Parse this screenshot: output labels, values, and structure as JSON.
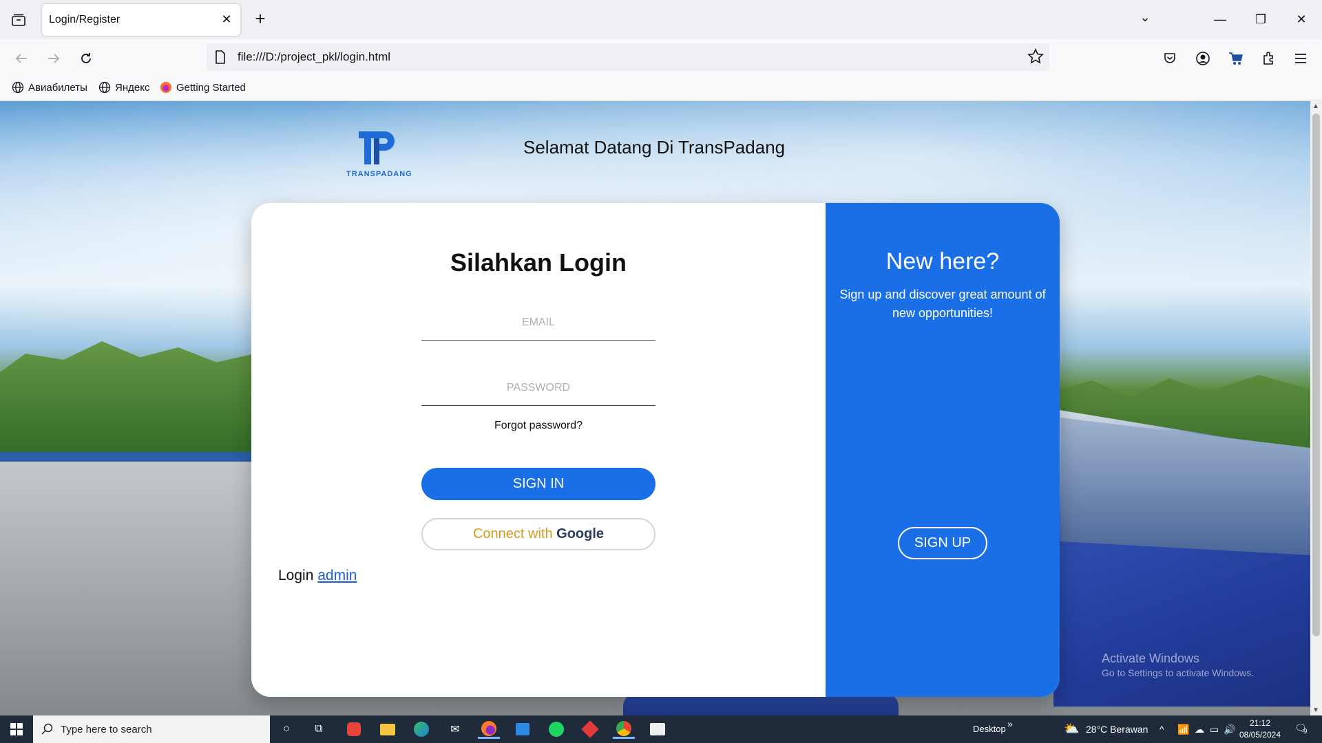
{
  "browser": {
    "tab_title": "Login/Register",
    "url": "file:///D:/project_pkl/login.html",
    "bookmarks": [
      {
        "label": "Авиабилеты",
        "icon": "globe-icon"
      },
      {
        "label": "Яндекс",
        "icon": "globe-icon"
      },
      {
        "label": "Getting Started",
        "icon": "firefox-icon"
      }
    ]
  },
  "page": {
    "brand_text": "TRANSPADANG",
    "welcome": "Selamat Datang Di TransPadang",
    "login": {
      "title": "Silahkan Login",
      "email_placeholder": "EMAIL",
      "password_placeholder": "PASSWORD",
      "forgot": "Forgot password?",
      "signin": "SIGN IN",
      "google_prefix": "Connect with",
      "google_brand": "Google",
      "admin_prefix": "Login",
      "admin_link": "admin"
    },
    "signup_panel": {
      "title": "New here?",
      "description": "Sign up and discover great amount of new opportunities!",
      "button": "SIGN UP"
    },
    "watermark": {
      "title": "Activate Windows",
      "subtitle": "Go to Settings to activate Windows."
    }
  },
  "taskbar": {
    "search_placeholder": "Type here to search",
    "desktop_label": "Desktop",
    "weather": "28°C  Berawan",
    "time": "21:12",
    "date": "08/05/2024",
    "notification_count": "9"
  },
  "colors": {
    "accent": "#1a6ee6",
    "google_text": "#d89a1e"
  }
}
